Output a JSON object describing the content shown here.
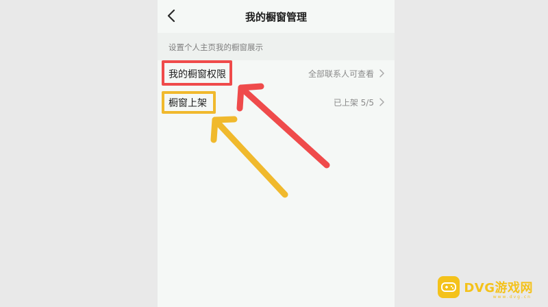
{
  "header": {
    "title": "我的橱窗管理"
  },
  "section": {
    "label": "设置个人主页我的橱窗展示"
  },
  "rows": [
    {
      "label": "我的橱窗权限",
      "value": "全部联系人可查看"
    },
    {
      "label": "橱窗上架",
      "value": "已上架 5/5"
    }
  ],
  "icons": {
    "back": "back-icon",
    "chevron": "chevron-right-icon",
    "watermark_logo": "gamepad-icon"
  },
  "watermark": {
    "text": "DVG游戏网",
    "sub": "www.dvg.cn"
  },
  "colors": {
    "highlight_red": "#ef4b4b",
    "highlight_yellow": "#f0b92d",
    "watermark": "#f4c21b"
  }
}
